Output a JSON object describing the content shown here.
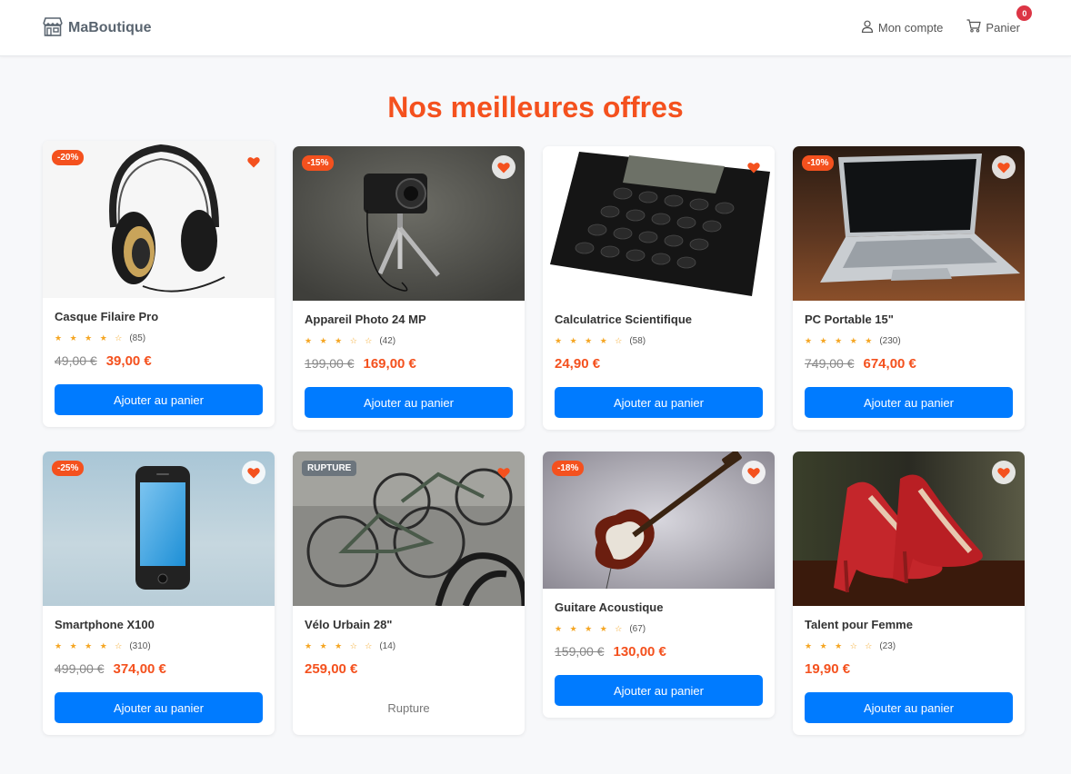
{
  "header": {
    "logo_text": "MaBoutique",
    "account_label": "Mon compte",
    "cart_label": "Panier",
    "cart_count": "0"
  },
  "page_title": "Nos meilleures offres",
  "products": [
    {
      "name": "Casque Filaire Pro",
      "badge": "-20%",
      "stars": "★ ★ ★ ★ ☆",
      "reviews": "(85)",
      "old_price": "49,00 €",
      "price": "39,00 €",
      "button": "Ajouter au panier"
    },
    {
      "name": "Appareil Photo 24 MP",
      "badge": "-15%",
      "stars": "★ ★ ★ ☆ ☆",
      "reviews": "(42)",
      "old_price": "199,00 €",
      "price": "169,00 €",
      "button": "Ajouter au panier"
    },
    {
      "name": "Calculatrice Scientifique",
      "badge": "",
      "stars": "★ ★ ★ ★ ☆",
      "reviews": "(58)",
      "old_price": "",
      "price": "24,90 €",
      "button": "Ajouter au panier"
    },
    {
      "name": "PC Portable 15\"",
      "badge": "-10%",
      "stars": "★ ★ ★ ★ ★",
      "reviews": "(230)",
      "old_price": "749,00 €",
      "price": "674,00 €",
      "button": "Ajouter au panier"
    },
    {
      "name": "Smartphone X100",
      "badge": "-25%",
      "stars": "★ ★ ★ ★ ☆",
      "reviews": "(310)",
      "old_price": "499,00 €",
      "price": "374,00 €",
      "button": "Ajouter au panier"
    },
    {
      "name": "Vélo Urbain 28\"",
      "badge": "RUPTURE",
      "stars": "★ ★ ★ ☆ ☆",
      "reviews": "(14)",
      "old_price": "",
      "price": "259,00 €",
      "button": "Rupture"
    },
    {
      "name": "Guitare Acoustique",
      "badge": "-18%",
      "stars": "★ ★ ★ ★ ☆",
      "reviews": "(67)",
      "old_price": "159,00 €",
      "price": "130,00 €",
      "button": "Ajouter au panier"
    },
    {
      "name": "Talent pour Femme",
      "badge": "",
      "stars": "★ ★ ★ ☆ ☆",
      "reviews": "(23)",
      "old_price": "",
      "price": "19,90 €",
      "button": "Ajouter au panier"
    }
  ],
  "colors": {
    "accent": "#f4511e",
    "primary": "#007bff",
    "badge_red": "#dc3545"
  },
  "icons": {
    "logo": "store-icon",
    "account": "user-icon",
    "cart": "cart-icon",
    "favorite": "heart-icon"
  }
}
